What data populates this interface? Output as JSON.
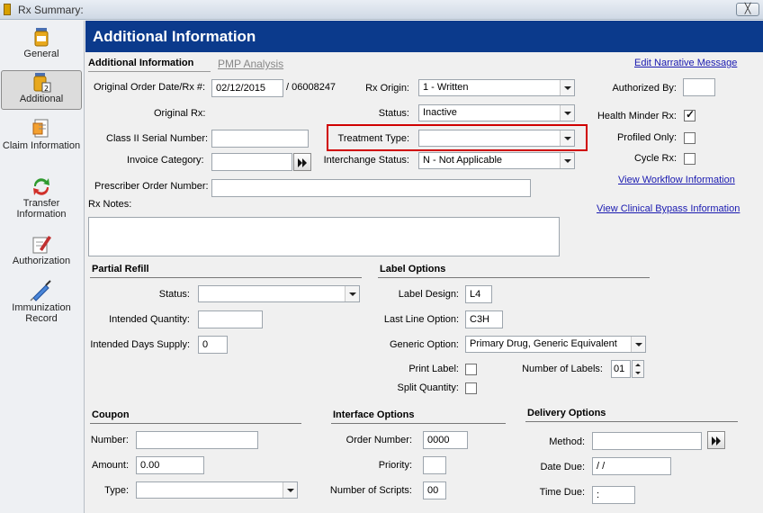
{
  "window": {
    "title": "Rx Summary:",
    "close_label": "╳"
  },
  "sidebar": {
    "items": [
      {
        "label": "General"
      },
      {
        "label": "Additional"
      },
      {
        "label": "Claim Information"
      },
      {
        "label": "Transfer Information"
      },
      {
        "label": "Authorization"
      },
      {
        "label": "Immunization Record"
      }
    ]
  },
  "header": {
    "title": "Additional Information"
  },
  "tabs": {
    "active": "Additional Information",
    "inactive": "PMP Analysis"
  },
  "links": {
    "edit_narrative": "Edit Narrative Message",
    "view_workflow": "View Workflow Information",
    "view_clinical": "View Clinical Bypass Information"
  },
  "form": {
    "original_order_label": "Original Order Date/Rx #:",
    "original_order_date": "02/12/2015",
    "rx_number": "/ 06008247",
    "original_rx_label": "Original Rx:",
    "class2_label": "Class II Serial Number:",
    "class2_value": "",
    "invoice_label": "Invoice Category:",
    "invoice_value": "",
    "prescriber_order_label": "Prescriber Order Number:",
    "prescriber_order_value": "",
    "rx_notes_label": "Rx Notes:",
    "rx_notes_value": "",
    "rx_origin_label": "Rx Origin:",
    "rx_origin_value": "1 - Written",
    "status_label": "Status:",
    "status_value": "Inactive",
    "treatment_label": "Treatment Type:",
    "treatment_value": "",
    "interchange_label": "Interchange Status:",
    "interchange_value": "N - Not Applicable",
    "authorized_by_label": "Authorized By:",
    "authorized_by_value": "",
    "health_minder_label": "Health Minder Rx:",
    "profiled_only_label": "Profiled Only:",
    "cycle_rx_label": "Cycle Rx:"
  },
  "partial_refill": {
    "title": "Partial Refill",
    "status_label": "Status:",
    "status_value": "",
    "intended_qty_label": "Intended Quantity:",
    "intended_qty_value": "",
    "intended_days_label": "Intended Days Supply:",
    "intended_days_value": "0"
  },
  "label_options": {
    "title": "Label Options",
    "label_design_label": "Label Design:",
    "label_design_value": "L4",
    "last_line_label": "Last Line Option:",
    "last_line_value": "C3H",
    "generic_label": "Generic Option:",
    "generic_value": "Primary Drug, Generic Equivalent",
    "print_label_label": "Print Label:",
    "split_qty_label": "Split Quantity:",
    "num_labels_label": "Number of Labels:",
    "num_labels_value": "01"
  },
  "coupon": {
    "title": "Coupon",
    "number_label": "Number:",
    "number_value": "",
    "amount_label": "Amount:",
    "amount_value": "0.00",
    "type_label": "Type:",
    "type_value": ""
  },
  "interface_options": {
    "title": "Interface Options",
    "order_number_label": "Order Number:",
    "order_number_value": "0000",
    "priority_label": "Priority:",
    "priority_value": "",
    "num_scripts_label": "Number of Scripts:",
    "num_scripts_value": "00"
  },
  "delivery_options": {
    "title": "Delivery Options",
    "method_label": "Method:",
    "method_value": "",
    "date_due_label": "Date Due:",
    "date_due_value": " / /",
    "time_due_label": "Time Due:",
    "time_due_value": " :"
  },
  "checkbox_states": {
    "health_minder": true,
    "profiled_only": false,
    "cycle_rx": false,
    "print_label": false,
    "split_qty": false
  },
  "colors": {
    "header_bg": "#0b3a8c",
    "highlight": "#d00000",
    "link": "#1a1ab0"
  }
}
